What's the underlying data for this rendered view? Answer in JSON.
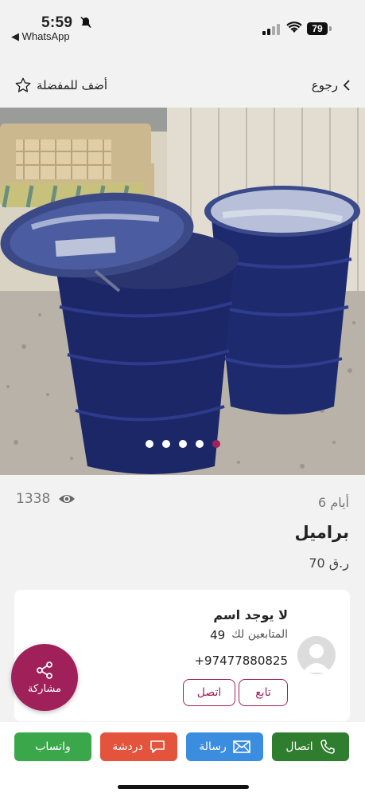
{
  "status_bar": {
    "time": "5:59",
    "back_app": "◀ WhatsApp",
    "battery": "79"
  },
  "nav": {
    "favorite_label": "أضف للمفضلة",
    "back_label": "رجوع"
  },
  "gallery": {
    "image_count": 5,
    "active_index": 4
  },
  "listing": {
    "views": "1338",
    "age": "6 أيام",
    "title": "براميل",
    "price": "70 ر.ق"
  },
  "seller": {
    "name": "لا يوجد اسم",
    "followers_label": "المتابعين لك",
    "followers_count": "49",
    "phone": "+97477880825",
    "follow_label": "تابع",
    "call_label": "اتصل"
  },
  "share": {
    "label": "مشاركة"
  },
  "actions": {
    "whatsapp": "واتساب",
    "chat": "دردشة",
    "message": "رسالة",
    "call": "اتصال"
  },
  "colors": {
    "brand": "#a0215a",
    "whatsapp": "#3aa74a",
    "chat": "#e4543c",
    "message": "#3b8de0",
    "call": "#2f7d2e"
  }
}
